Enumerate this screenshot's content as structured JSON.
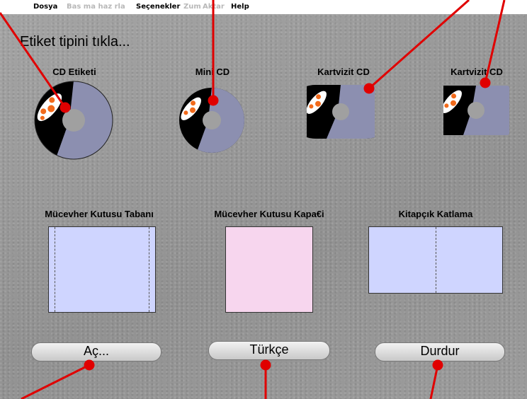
{
  "menu": {
    "items": [
      {
        "label": "Dosya",
        "enabled": true
      },
      {
        "label": "Bas ma haz rla",
        "enabled": false
      },
      {
        "label": "Seçenekler",
        "enabled": true
      },
      {
        "label": "Zum",
        "enabled": false
      },
      {
        "label": "Aktar",
        "enabled": false
      },
      {
        "label": "Help",
        "enabled": true
      }
    ]
  },
  "prompt": "Etiket tipini tıkla...",
  "label_types": [
    {
      "label": "CD Etiketi"
    },
    {
      "label": "Mini CD"
    },
    {
      "label": "Kartvizit CD"
    },
    {
      "label": "Kartvizit CD"
    }
  ],
  "case_types": [
    {
      "label": "Mücevher Kutusu Tabanı",
      "color": "#cfd5ff"
    },
    {
      "label": "Mücevher Kutusu Kapa€i",
      "color": "#f7d6ee"
    },
    {
      "label": "Kitapçık Katlama",
      "color": "#cfd5ff"
    }
  ],
  "buttons": {
    "open": "Aç...",
    "language": "Türkçe",
    "stop": "Durdur"
  },
  "colors": {
    "callout": "#e00000",
    "disc_tint": "#8c8fb0",
    "disc_dark": "#000000"
  }
}
